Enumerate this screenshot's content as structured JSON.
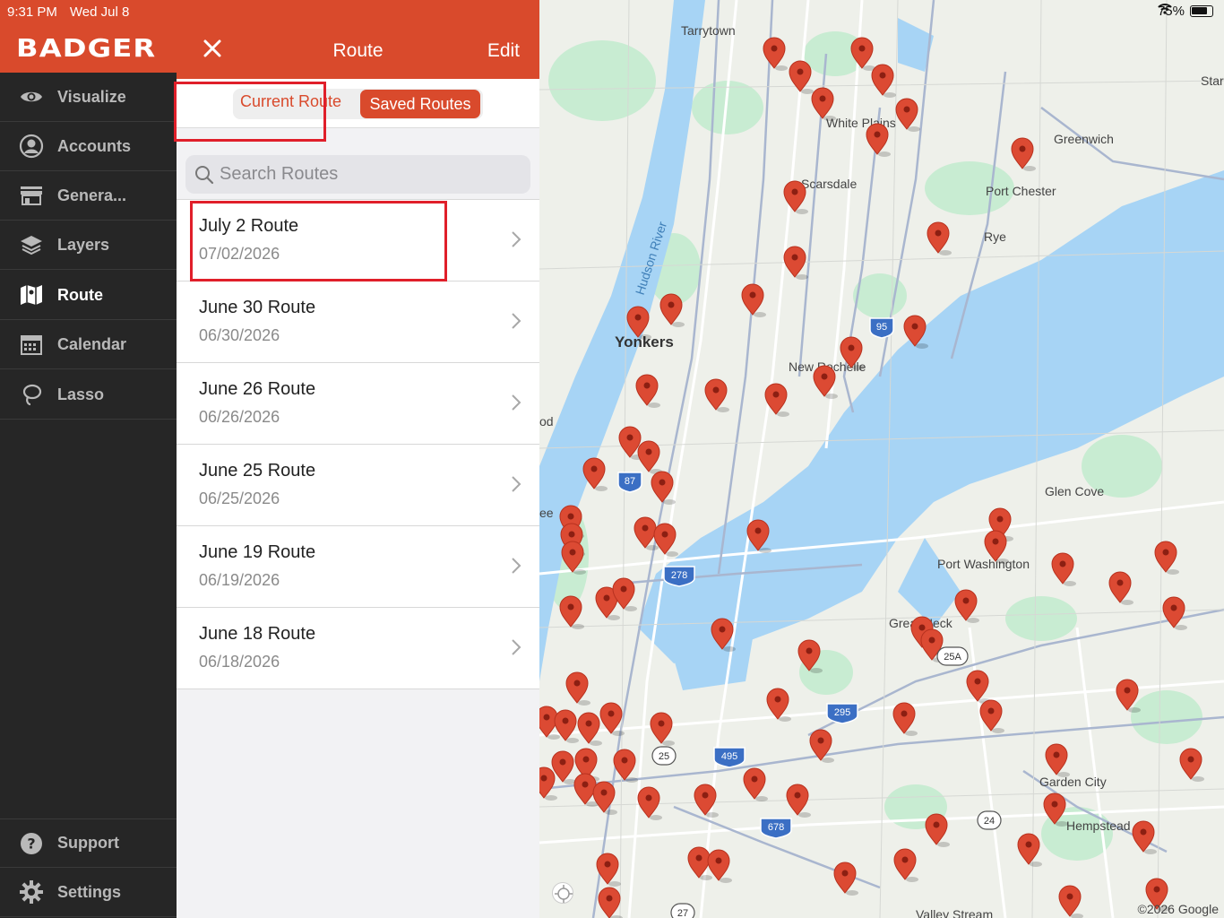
{
  "status": {
    "time": "9:31 PM",
    "date": "Wed Jul 8",
    "battery": "75%",
    "battery_level": 0.75
  },
  "app": {
    "logo": "BADGER"
  },
  "sidebar": {
    "items": [
      {
        "label": "Visualize",
        "icon": "eye-icon"
      },
      {
        "label": "Accounts",
        "icon": "person-icon"
      },
      {
        "label": "Genera...",
        "icon": "store-icon"
      },
      {
        "label": "Layers",
        "icon": "layers-icon"
      },
      {
        "label": "Route",
        "icon": "map-icon",
        "active": true
      },
      {
        "label": "Calendar",
        "icon": "calendar-icon"
      },
      {
        "label": "Lasso",
        "icon": "lasso-icon"
      }
    ],
    "footer": [
      {
        "label": "Support",
        "icon": "help-icon"
      },
      {
        "label": "Settings",
        "icon": "gear-icon"
      }
    ]
  },
  "panel": {
    "title": "Route",
    "close_icon": "close-icon",
    "edit_label": "Edit",
    "tabs": {
      "current": "Current Route",
      "saved": "Saved Routes",
      "selected": "Saved Routes"
    },
    "search": {
      "placeholder": "Search Routes"
    },
    "routes": [
      {
        "name": "July 2 Route",
        "date": "07/02/2026"
      },
      {
        "name": "June 30 Route",
        "date": "06/30/2026"
      },
      {
        "name": "June 26 Route",
        "date": "06/26/2026"
      },
      {
        "name": "June 25 Route",
        "date": "06/25/2026"
      },
      {
        "name": "June 19 Route",
        "date": "06/19/2026"
      },
      {
        "name": "June 18 Route",
        "date": "06/18/2026"
      }
    ]
  },
  "map": {
    "labels": [
      "Tarrytown",
      "White Plains",
      "Greenwich",
      "Port Chester",
      "Scarsdale",
      "Rye",
      "Hudson River",
      "Yonkers",
      "New Rochelle",
      "Glen Cove",
      "Port Washington",
      "Great Neck",
      "Garden City",
      "Hempstead",
      "Valley Stream",
      "Star",
      "od",
      "ee"
    ],
    "route_shields": [
      "95",
      "87",
      "278",
      "295",
      "495",
      "25",
      "25A",
      "678",
      "24",
      "27"
    ],
    "copyright": "©2026 Google",
    "colors": {
      "water": "#a7d4f5",
      "park": "#c8ecd2",
      "pin": "#dc4a33",
      "brand": "#d94a2c"
    }
  }
}
